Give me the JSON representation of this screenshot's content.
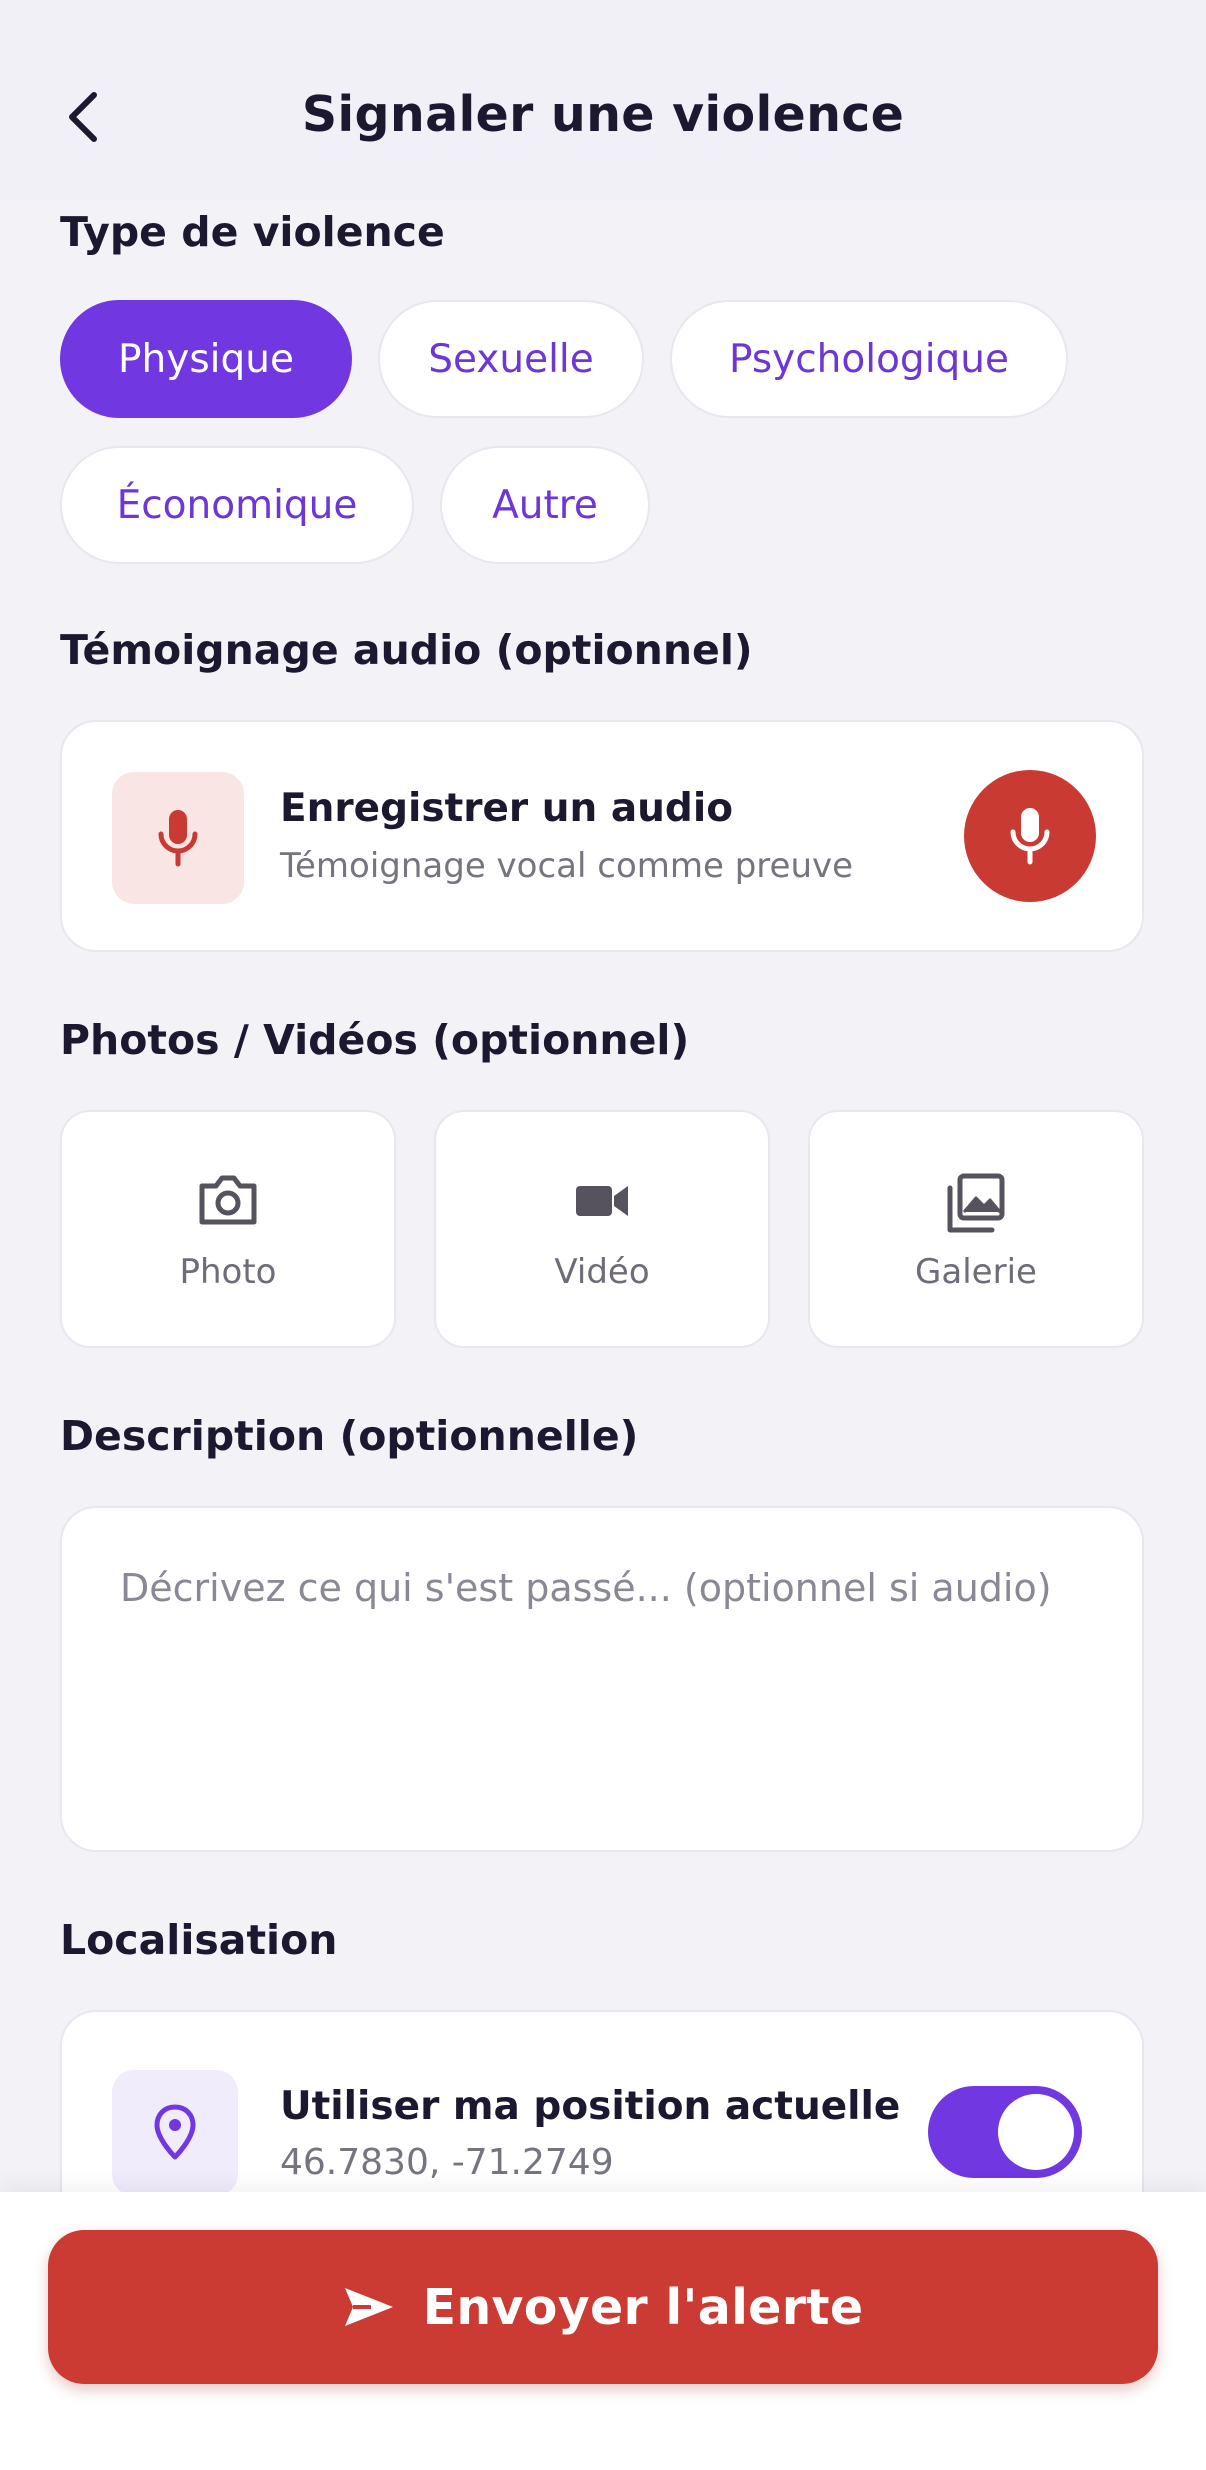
{
  "header": {
    "title": "Signaler une violence",
    "back_icon": "chevron-left-icon"
  },
  "violence_type": {
    "label": "Type de violence",
    "options": [
      "Physique",
      "Sexuelle",
      "Psychologique",
      "Économique",
      "Autre"
    ],
    "selected": "Physique"
  },
  "audio": {
    "label": "Témoignage audio (optionnel)",
    "title": "Enregistrer un audio",
    "subtitle": "Témoignage vocal comme preuve",
    "icon": "microphone-icon"
  },
  "media": {
    "label": "Photos / Vidéos (optionnel)",
    "items": [
      {
        "label": "Photo",
        "icon": "camera-icon"
      },
      {
        "label": "Vidéo",
        "icon": "video-camera-icon"
      },
      {
        "label": "Galerie",
        "icon": "gallery-icon"
      }
    ]
  },
  "description": {
    "label": "Description (optionnelle)",
    "placeholder": "Décrivez ce qui s'est passé... (optionnel si audio)"
  },
  "location": {
    "label": "Localisation",
    "title": "Utiliser ma position actuelle",
    "coords": "46.7830, -71.2749",
    "toggle_on": true,
    "icon": "location-pin-icon"
  },
  "submit": {
    "label": "Envoyer l'alerte",
    "icon": "send-icon"
  },
  "colors": {
    "accent": "#7137e0",
    "danger": "#cb3a33",
    "background": "#f3f2f7"
  }
}
